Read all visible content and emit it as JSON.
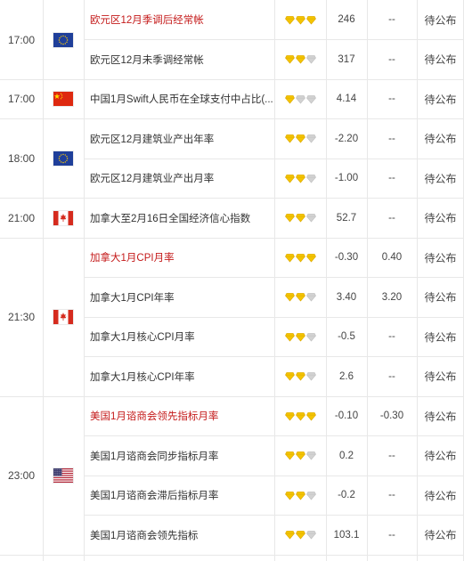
{
  "colors": {
    "highlight_text": "#c41a1a",
    "star_active": "#f4c400",
    "star_inactive": "#d2d2d2",
    "grid_line": "#e8e8e8"
  },
  "groups": [
    {
      "time": "17:00",
      "flag": "eu-flag",
      "rows": [
        {
          "event": "欧元区12月季调后经常帐",
          "highlight": true,
          "stars": 3,
          "previous": "246",
          "forecast": "--",
          "status": "待公布"
        },
        {
          "event": "欧元区12月未季调经常帐",
          "highlight": false,
          "stars": 2,
          "previous": "317",
          "forecast": "--",
          "status": "待公布"
        }
      ]
    },
    {
      "time": "17:00",
      "flag": "cn-flag",
      "rows": [
        {
          "event": "中国1月Swift人民币在全球支付中占比(...",
          "highlight": false,
          "stars": 1,
          "previous": "4.14",
          "forecast": "--",
          "status": "待公布"
        }
      ]
    },
    {
      "time": "18:00",
      "flag": "eu-flag",
      "rows": [
        {
          "event": "欧元区12月建筑业产出年率",
          "highlight": false,
          "stars": 2,
          "previous": "-2.20",
          "forecast": "--",
          "status": "待公布"
        },
        {
          "event": "欧元区12月建筑业产出月率",
          "highlight": false,
          "stars": 2,
          "previous": "-1.00",
          "forecast": "--",
          "status": "待公布"
        }
      ]
    },
    {
      "time": "21:00",
      "flag": "ca-flag",
      "rows": [
        {
          "event": "加拿大至2月16日全国经济信心指数",
          "highlight": false,
          "stars": 2,
          "previous": "52.7",
          "forecast": "--",
          "status": "待公布"
        }
      ]
    },
    {
      "time": "21:30",
      "flag": "ca-flag",
      "rows": [
        {
          "event": "加拿大1月CPI月率",
          "highlight": true,
          "stars": 3,
          "previous": "-0.30",
          "forecast": "0.40",
          "status": "待公布"
        },
        {
          "event": "加拿大1月CPI年率",
          "highlight": false,
          "stars": 2,
          "previous": "3.40",
          "forecast": "3.20",
          "status": "待公布"
        },
        {
          "event": "加拿大1月核心CPI月率",
          "highlight": false,
          "stars": 2,
          "previous": "-0.5",
          "forecast": "--",
          "status": "待公布"
        },
        {
          "event": "加拿大1月核心CPI年率",
          "highlight": false,
          "stars": 2,
          "previous": "2.6",
          "forecast": "--",
          "status": "待公布"
        }
      ]
    },
    {
      "time": "23:00",
      "flag": "us-flag",
      "rows": [
        {
          "event": "美国1月谘商会领先指标月率",
          "highlight": true,
          "stars": 3,
          "previous": "-0.10",
          "forecast": "-0.30",
          "status": "待公布"
        },
        {
          "event": "美国1月谘商会同步指标月率",
          "highlight": false,
          "stars": 2,
          "previous": "0.2",
          "forecast": "--",
          "status": "待公布"
        },
        {
          "event": "美国1月谘商会滞后指标月率",
          "highlight": false,
          "stars": 2,
          "previous": "-0.2",
          "forecast": "--",
          "status": "待公布"
        },
        {
          "event": "美国1月谘商会领先指标",
          "highlight": false,
          "stars": 2,
          "previous": "103.1",
          "forecast": "--",
          "status": "待公布"
        }
      ]
    }
  ]
}
